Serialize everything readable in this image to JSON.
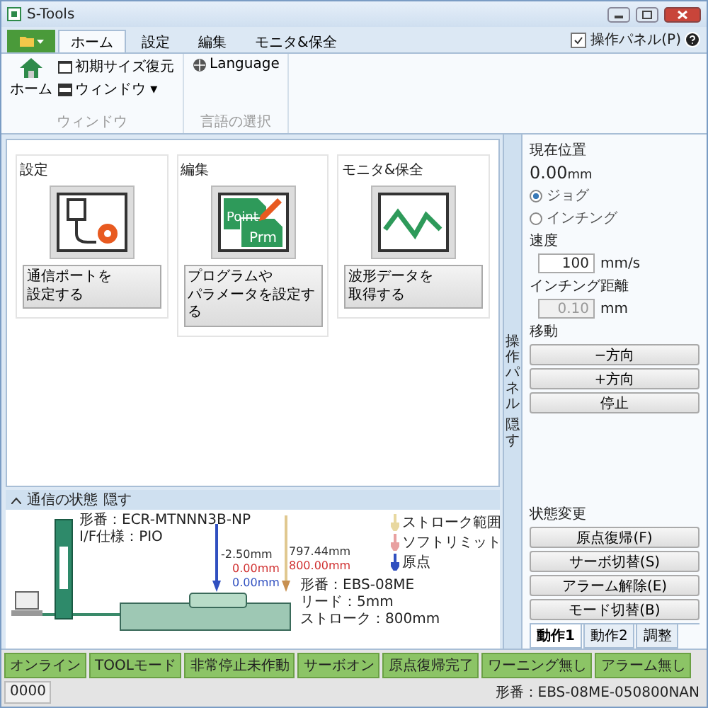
{
  "window": {
    "title": "S-Tools"
  },
  "ribbon_tabs": [
    {
      "label": "ホーム",
      "selected": true
    },
    {
      "label": "設定",
      "selected": false
    },
    {
      "label": "編集",
      "selected": false
    },
    {
      "label": "モニタ&保全",
      "selected": false
    }
  ],
  "panel_toggle": {
    "label": "操作パネル(P)",
    "checked": true
  },
  "ribbon_groups": [
    {
      "label": "ウィンドウ",
      "items": [
        {
          "kind": "large",
          "label": "ホーム"
        },
        {
          "kind": "small",
          "label": "初期サイズ復元"
        },
        {
          "kind": "small",
          "label": "ウィンドウ ▾"
        }
      ]
    },
    {
      "label": "言語の選択",
      "items": [
        {
          "kind": "small",
          "label": "Language"
        }
      ]
    }
  ],
  "cards": [
    {
      "title": "設定",
      "button": [
        "通信ポートを",
        "設定する"
      ]
    },
    {
      "title": "編集",
      "icon_texts": [
        "Point",
        "Prm"
      ],
      "button": [
        "プログラムや",
        "パラメータを設定する"
      ]
    },
    {
      "title": "モニタ&保全",
      "button": [
        "波形データを",
        "取得する"
      ]
    }
  ],
  "diagram": {
    "title": "通信の状態",
    "hide_link": "隠す",
    "controller": [
      "形番：ECR-MTNNN3B-NP",
      "I/F仕様：PIO"
    ],
    "measures": [
      {
        "text": "-2.50mm",
        "color": "#333333"
      },
      {
        "text": "0.00mm",
        "color": "#d03030"
      },
      {
        "text": "0.00mm",
        "color": "#3050c0"
      },
      {
        "text": "797.44mm",
        "color": "#333333"
      },
      {
        "text": "800.00mm",
        "color": "#d03030"
      }
    ],
    "actuator": [
      "形番：EBS-08ME",
      "リード：5mm",
      "ストローク：800mm"
    ],
    "legend": [
      {
        "label": "ストローク範囲",
        "color": "#e8d8a0"
      },
      {
        "label": "ソフトリミット",
        "color": "#e8a0a0"
      },
      {
        "label": "原点",
        "color": "#3050c0"
      }
    ]
  },
  "side_strip": {
    "label": "操作パネル",
    "action": "隠す"
  },
  "control_panel": {
    "position_label": "現在位置",
    "position_value": "0.00",
    "position_unit": "mm",
    "modes": [
      {
        "label": "ジョグ",
        "selected": true
      },
      {
        "label": "インチング",
        "selected": false
      }
    ],
    "speed": {
      "label": "速度",
      "value": "100",
      "unit": "mm/s",
      "disabled": false
    },
    "inching": {
      "label": "インチング距離",
      "value": "0.10",
      "unit": "mm",
      "disabled": true
    },
    "move_label": "移動",
    "move_buttons": [
      "−方向",
      "+方向",
      "停止"
    ],
    "state_label": "状態変更",
    "state_buttons": [
      "原点復帰(F)",
      "サーボ切替(S)",
      "アラーム解除(E)",
      "モード切替(B)"
    ],
    "tabs": [
      {
        "label": "動作1",
        "selected": true
      },
      {
        "label": "動作2",
        "selected": false
      },
      {
        "label": "調整",
        "selected": false
      }
    ]
  },
  "status_bar": {
    "items": [
      {
        "label": "オンライン",
        "on": true
      },
      {
        "label": "TOOLモード",
        "on": true
      },
      {
        "label": "非常停止未作動",
        "on": true
      },
      {
        "label": "サーボオン",
        "on": true
      },
      {
        "label": "原点復帰完了",
        "on": true
      },
      {
        "label": "ワーニング無し",
        "on": true
      },
      {
        "label": "アラーム無し",
        "on": true
      },
      {
        "label": "0000",
        "on": false
      }
    ],
    "model": "形番：EBS-08ME-050800NAN"
  }
}
